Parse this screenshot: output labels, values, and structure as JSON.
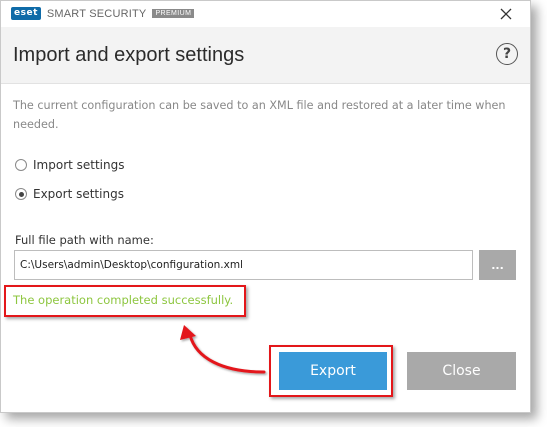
{
  "titlebar": {
    "logo_text": "eset",
    "product_name": "SMART SECURITY",
    "edition": "PREMIUM"
  },
  "header": {
    "title": "Import and export settings",
    "help_label": "?"
  },
  "description": "The current configuration can be saved to an XML file and restored at a later time when needed.",
  "options": [
    {
      "label": "Import settings",
      "checked": false
    },
    {
      "label": "Export settings",
      "checked": true
    }
  ],
  "path": {
    "label": "Full file path with name:",
    "value": "C:\\Users\\admin\\Desktop\\configuration.xml",
    "browse_label": "..."
  },
  "status": {
    "message": "The operation completed successfully.",
    "color": "#8dc63f"
  },
  "buttons": {
    "export_label": "Export",
    "close_label": "Close"
  },
  "colors": {
    "accent": "#3a9ad9",
    "highlight": "#e3171a",
    "neutral_button": "#a9a9a9"
  }
}
